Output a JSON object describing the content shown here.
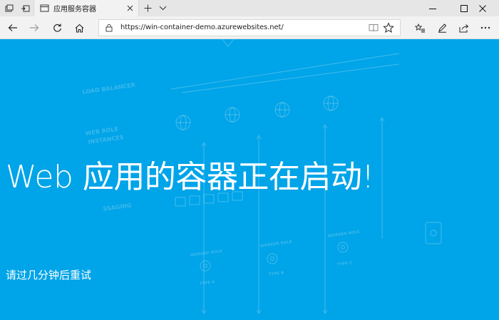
{
  "browser": {
    "tab": {
      "title": "应用服务容器"
    },
    "address": {
      "url": "https://win-container-demo.azurewebsites.net/"
    },
    "toolbar_icons": {
      "tab_actions": "tab-actions-icon",
      "set_aside": "set-aside-tabs-icon",
      "back": "back-arrow-icon",
      "forward": "forward-arrow-icon",
      "refresh": "refresh-icon",
      "home": "home-icon",
      "lock": "lock-icon",
      "reading_view": "reading-view-icon",
      "favorite": "star-icon",
      "favorites_hub": "favorites-hub-icon",
      "notes": "pen-icon",
      "share": "share-icon",
      "more": "more-icon"
    }
  },
  "page": {
    "headline": "Web 应用的容器正在启动!",
    "subtitle": "请过几分钟后重试",
    "background_art_labels": {
      "load_balancer": "LOAD BALANCER",
      "web_role_1": "WEB ROLE",
      "web_role_2": "INSTANCES",
      "messaging": "SSAGING",
      "worker_role_1": "WORKER ROLE",
      "worker_role_2": "WORKER ROLE",
      "worker_role_3": "WORKER ROLE",
      "type_a": "TYPE A",
      "type_b": "TYPE B",
      "type_c": "TYPE C"
    },
    "colors": {
      "background": "#00a4e8",
      "text": "#ffffff"
    }
  }
}
